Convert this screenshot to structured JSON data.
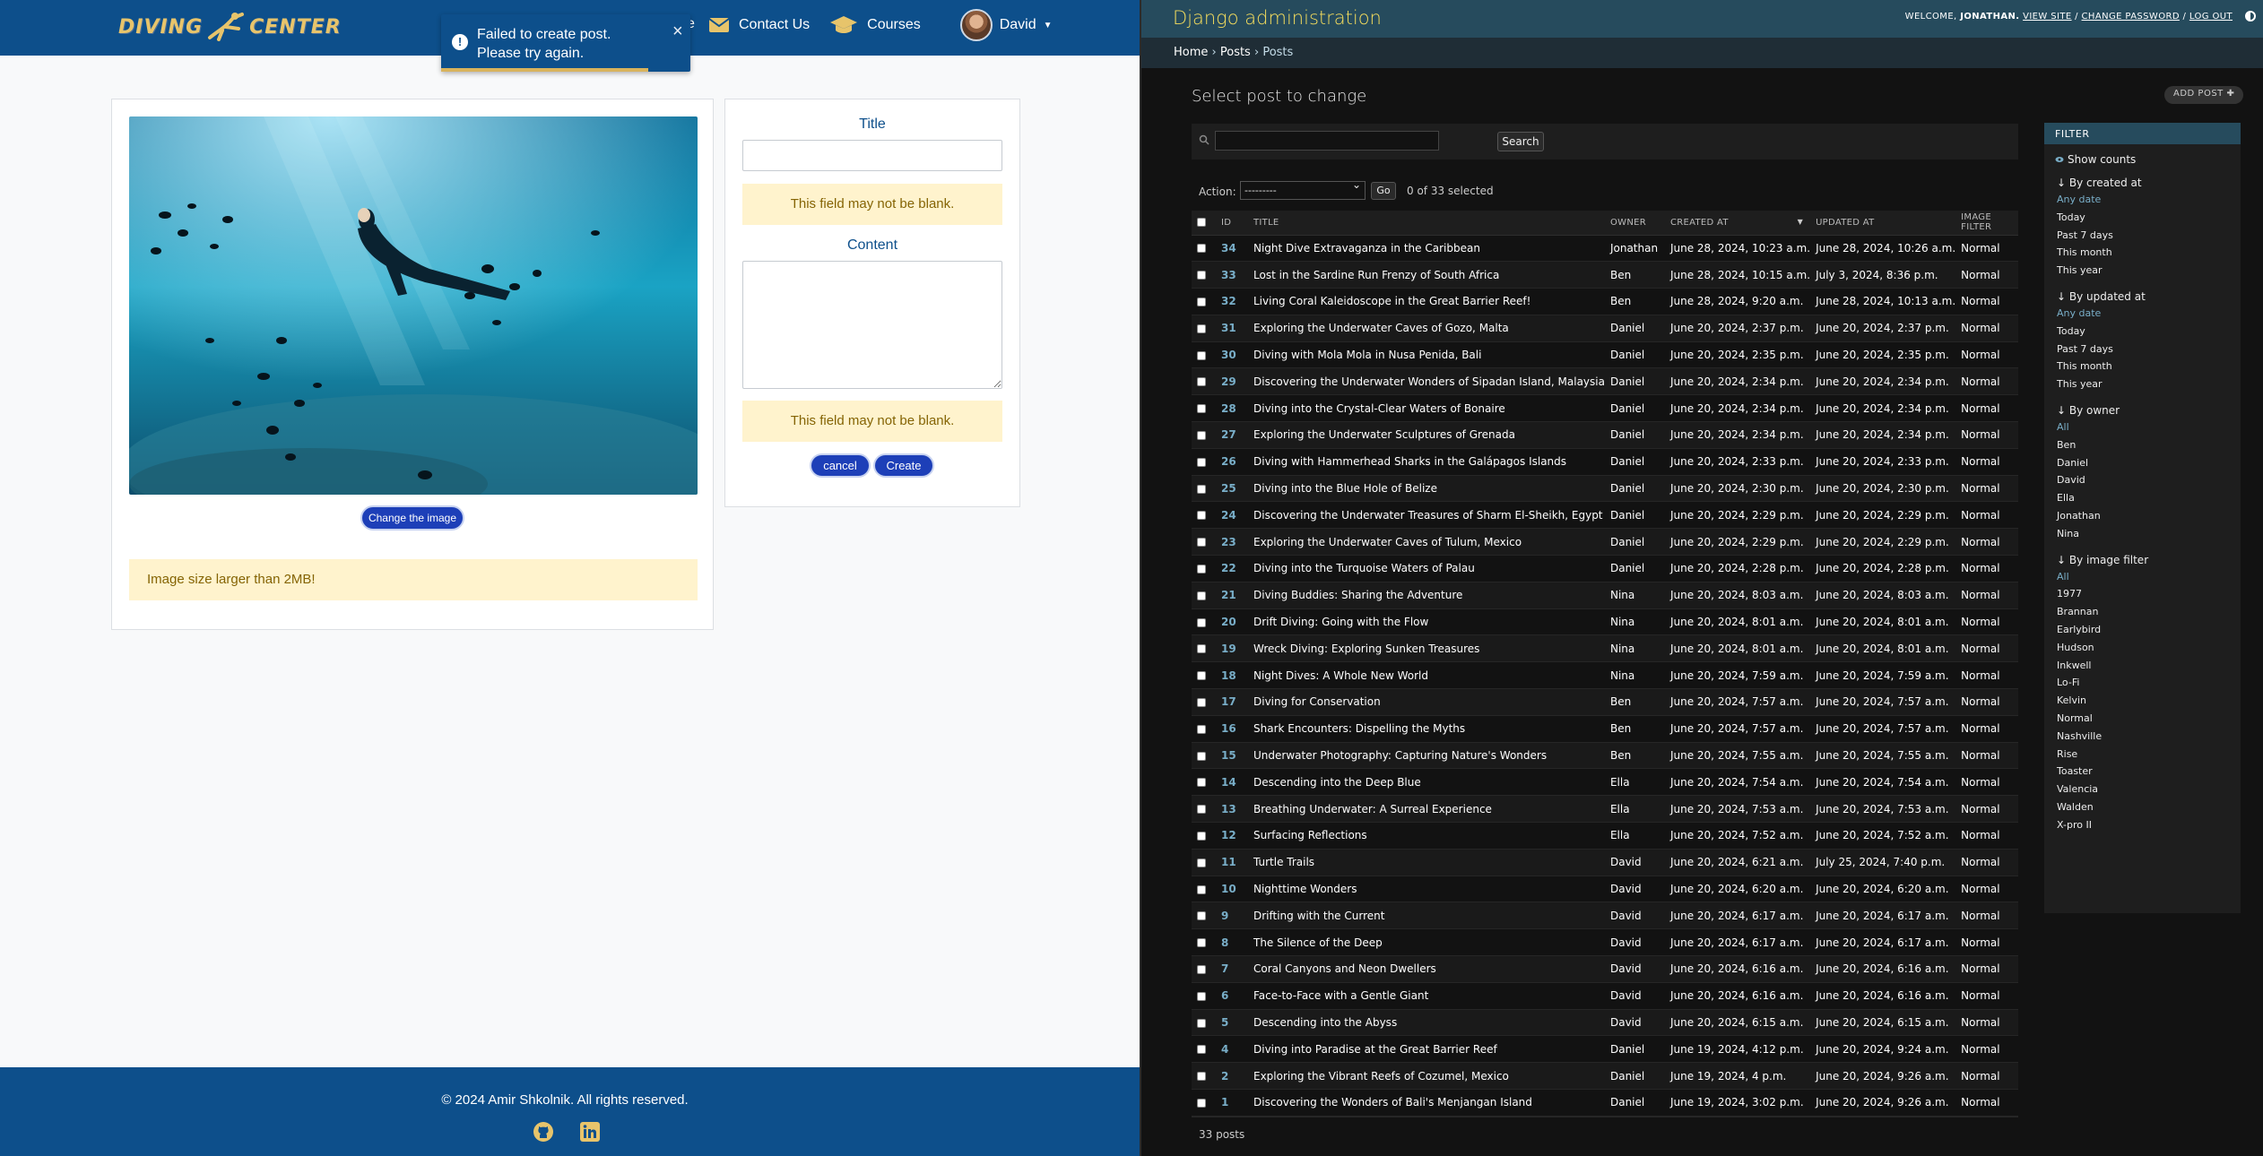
{
  "app": {
    "brand_left": "DIVING",
    "brand_right": "CENTER",
    "nav": {
      "contact": "Contact Us",
      "courses": "Courses",
      "user": "David"
    },
    "toast": {
      "message": "Failed to create post. Please try again.",
      "close": "×",
      "progress": 0.83
    },
    "image_card": {
      "change_button": "Change the image",
      "warning": "Image size larger than 2MB!"
    },
    "form": {
      "title_label": "Title",
      "title_value": "",
      "title_error": "This field may not be blank.",
      "content_label": "Content",
      "content_value": "",
      "content_error": "This field may not be blank.",
      "cancel_button": "cancel",
      "create_button": "Create"
    },
    "footer": {
      "copyright": "© 2024 Amir Shkolnik. All rights reserved."
    }
  },
  "admin": {
    "site_title": "Django administration",
    "welcome": "WELCOME,",
    "user": "JONATHAN.",
    "view_site": "VIEW SITE",
    "change_password": "CHANGE PASSWORD",
    "log_out": "LOG OUT",
    "sep": " / ",
    "breadcrumbs": {
      "home": "Home",
      "app": "Posts",
      "model": "Posts",
      "sep": " › "
    },
    "heading": "Select post to change",
    "add_button": "ADD POST",
    "search_button": "Search",
    "action_label": "Action:",
    "action_value": "---------",
    "go_button": "Go",
    "selected_count": "0 of 33 selected",
    "columns": [
      "ID",
      "TITLE",
      "OWNER",
      "CREATED AT",
      "UPDATED AT",
      "IMAGE FILTER"
    ],
    "rows": [
      [
        "34",
        "Night Dive Extravaganza in the Caribbean",
        "Jonathan",
        "June 28, 2024, 10:23 a.m.",
        "June 28, 2024, 10:26 a.m.",
        "Normal"
      ],
      [
        "33",
        "Lost in the Sardine Run Frenzy of South Africa",
        "Ben",
        "June 28, 2024, 10:15 a.m.",
        "July 3, 2024, 8:36 p.m.",
        "Normal"
      ],
      [
        "32",
        "Living Coral Kaleidoscope in the Great Barrier Reef!",
        "Ben",
        "June 28, 2024, 9:20 a.m.",
        "June 28, 2024, 10:13 a.m.",
        "Normal"
      ],
      [
        "31",
        "Exploring the Underwater Caves of Gozo, Malta",
        "Daniel",
        "June 20, 2024, 2:37 p.m.",
        "June 20, 2024, 2:37 p.m.",
        "Normal"
      ],
      [
        "30",
        "Diving with Mola Mola in Nusa Penida, Bali",
        "Daniel",
        "June 20, 2024, 2:35 p.m.",
        "June 20, 2024, 2:35 p.m.",
        "Normal"
      ],
      [
        "29",
        "Discovering the Underwater Wonders of Sipadan Island, Malaysia",
        "Daniel",
        "June 20, 2024, 2:34 p.m.",
        "June 20, 2024, 2:34 p.m.",
        "Normal"
      ],
      [
        "28",
        "Diving into the Crystal-Clear Waters of Bonaire",
        "Daniel",
        "June 20, 2024, 2:34 p.m.",
        "June 20, 2024, 2:34 p.m.",
        "Normal"
      ],
      [
        "27",
        "Exploring the Underwater Sculptures of Grenada",
        "Daniel",
        "June 20, 2024, 2:34 p.m.",
        "June 20, 2024, 2:34 p.m.",
        "Normal"
      ],
      [
        "26",
        "Diving with Hammerhead Sharks in the Galápagos Islands",
        "Daniel",
        "June 20, 2024, 2:33 p.m.",
        "June 20, 2024, 2:33 p.m.",
        "Normal"
      ],
      [
        "25",
        "Diving into the Blue Hole of Belize",
        "Daniel",
        "June 20, 2024, 2:30 p.m.",
        "June 20, 2024, 2:30 p.m.",
        "Normal"
      ],
      [
        "24",
        "Discovering the Underwater Treasures of Sharm El-Sheikh, Egypt",
        "Daniel",
        "June 20, 2024, 2:29 p.m.",
        "June 20, 2024, 2:29 p.m.",
        "Normal"
      ],
      [
        "23",
        "Exploring the Underwater Caves of Tulum, Mexico",
        "Daniel",
        "June 20, 2024, 2:29 p.m.",
        "June 20, 2024, 2:29 p.m.",
        "Normal"
      ],
      [
        "22",
        "Diving into the Turquoise Waters of Palau",
        "Daniel",
        "June 20, 2024, 2:28 p.m.",
        "June 20, 2024, 2:28 p.m.",
        "Normal"
      ],
      [
        "21",
        "Diving Buddies: Sharing the Adventure",
        "Nina",
        "June 20, 2024, 8:03 a.m.",
        "June 20, 2024, 8:03 a.m.",
        "Normal"
      ],
      [
        "20",
        "Drift Diving: Going with the Flow",
        "Nina",
        "June 20, 2024, 8:01 a.m.",
        "June 20, 2024, 8:01 a.m.",
        "Normal"
      ],
      [
        "19",
        "Wreck Diving: Exploring Sunken Treasures",
        "Nina",
        "June 20, 2024, 8:01 a.m.",
        "June 20, 2024, 8:01 a.m.",
        "Normal"
      ],
      [
        "18",
        "Night Dives: A Whole New World",
        "Nina",
        "June 20, 2024, 7:59 a.m.",
        "June 20, 2024, 7:59 a.m.",
        "Normal"
      ],
      [
        "17",
        "Diving for Conservation",
        "Ben",
        "June 20, 2024, 7:57 a.m.",
        "June 20, 2024, 7:57 a.m.",
        "Normal"
      ],
      [
        "16",
        "Shark Encounters: Dispelling the Myths",
        "Ben",
        "June 20, 2024, 7:57 a.m.",
        "June 20, 2024, 7:57 a.m.",
        "Normal"
      ],
      [
        "15",
        "Underwater Photography: Capturing Nature's Wonders",
        "Ben",
        "June 20, 2024, 7:55 a.m.",
        "June 20, 2024, 7:55 a.m.",
        "Normal"
      ],
      [
        "14",
        "Descending into the Deep Blue",
        "Ella",
        "June 20, 2024, 7:54 a.m.",
        "June 20, 2024, 7:54 a.m.",
        "Normal"
      ],
      [
        "13",
        "Breathing Underwater: A Surreal Experience",
        "Ella",
        "June 20, 2024, 7:53 a.m.",
        "June 20, 2024, 7:53 a.m.",
        "Normal"
      ],
      [
        "12",
        "Surfacing Reflections",
        "Ella",
        "June 20, 2024, 7:52 a.m.",
        "June 20, 2024, 7:52 a.m.",
        "Normal"
      ],
      [
        "11",
        "Turtle Trails",
        "David",
        "June 20, 2024, 6:21 a.m.",
        "July 25, 2024, 7:40 p.m.",
        "Normal"
      ],
      [
        "10",
        "Nighttime Wonders",
        "David",
        "June 20, 2024, 6:20 a.m.",
        "June 20, 2024, 6:20 a.m.",
        "Normal"
      ],
      [
        "9",
        "Drifting with the Current",
        "David",
        "June 20, 2024, 6:17 a.m.",
        "June 20, 2024, 6:17 a.m.",
        "Normal"
      ],
      [
        "8",
        "The Silence of the Deep",
        "David",
        "June 20, 2024, 6:17 a.m.",
        "June 20, 2024, 6:17 a.m.",
        "Normal"
      ],
      [
        "7",
        "Coral Canyons and Neon Dwellers",
        "David",
        "June 20, 2024, 6:16 a.m.",
        "June 20, 2024, 6:16 a.m.",
        "Normal"
      ],
      [
        "6",
        "Face-to-Face with a Gentle Giant",
        "David",
        "June 20, 2024, 6:16 a.m.",
        "June 20, 2024, 6:16 a.m.",
        "Normal"
      ],
      [
        "5",
        "Descending into the Abyss",
        "David",
        "June 20, 2024, 6:15 a.m.",
        "June 20, 2024, 6:15 a.m.",
        "Normal"
      ],
      [
        "4",
        "Diving into Paradise at the Great Barrier Reef",
        "Daniel",
        "June 19, 2024, 4:12 p.m.",
        "June 20, 2024, 9:24 a.m.",
        "Normal"
      ],
      [
        "2",
        "Exploring the Vibrant Reefs of Cozumel, Mexico",
        "Daniel",
        "June 19, 2024, 4 p.m.",
        "June 20, 2024, 9:26 a.m.",
        "Normal"
      ],
      [
        "1",
        "Discovering the Wonders of Bali's Menjangan Island",
        "Daniel",
        "June 19, 2024, 3:02 p.m.",
        "June 20, 2024, 9:26 a.m.",
        "Normal"
      ]
    ],
    "paginator": "33 posts",
    "filter": {
      "title": "FILTER",
      "show_counts": "Show counts",
      "groups": [
        {
          "title": "↓ By created at",
          "items": [
            "Any date",
            "Today",
            "Past 7 days",
            "This month",
            "This year"
          ]
        },
        {
          "title": "↓ By updated at",
          "items": [
            "Any date",
            "Today",
            "Past 7 days",
            "This month",
            "This year"
          ]
        },
        {
          "title": "↓ By owner",
          "items": [
            "All",
            "Ben",
            "Daniel",
            "David",
            "Ella",
            "Jonathan",
            "Nina"
          ]
        },
        {
          "title": "↓ By image filter",
          "items": [
            "All",
            "1977",
            "Brannan",
            "Earlybird",
            "Hudson",
            "Inkwell",
            "Lo-Fi",
            "Kelvin",
            "Normal",
            "Nashville",
            "Rise",
            "Toaster",
            "Valencia",
            "Walden",
            "X-pro II"
          ]
        }
      ]
    }
  },
  "colors": {
    "app_nav": "#0d4f8b",
    "app_button": "#1d3fb8",
    "warning_bg": "#fff3cd",
    "admin_header": "#264b5d",
    "admin_title": "#f5dd5d",
    "admin_link": "#79aec8"
  }
}
